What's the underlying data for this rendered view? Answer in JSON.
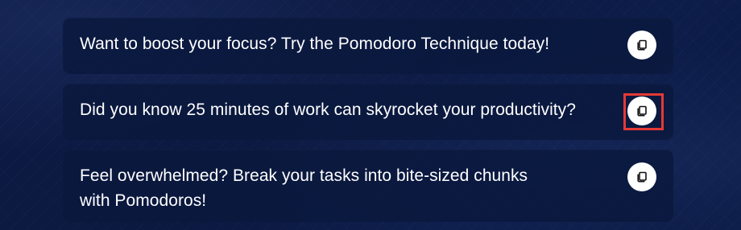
{
  "messages": [
    {
      "text": "Want to boost your focus? Try the Pomodoro Technique today!",
      "icon": "copy-icon"
    },
    {
      "text": "Did you know 25 minutes of work can skyrocket your productivity?",
      "icon": "copy-icon",
      "highlighted": true
    },
    {
      "text": "Feel overwhelmed? Break your tasks into bite-sized chunks with Pomodoros!",
      "icon": "copy-icon"
    }
  ],
  "colors": {
    "background": "#0b1940",
    "card": "#0a183e",
    "text": "#ffffff",
    "highlight": "#e53935",
    "button": "#ffffff",
    "icon": "#111111"
  }
}
